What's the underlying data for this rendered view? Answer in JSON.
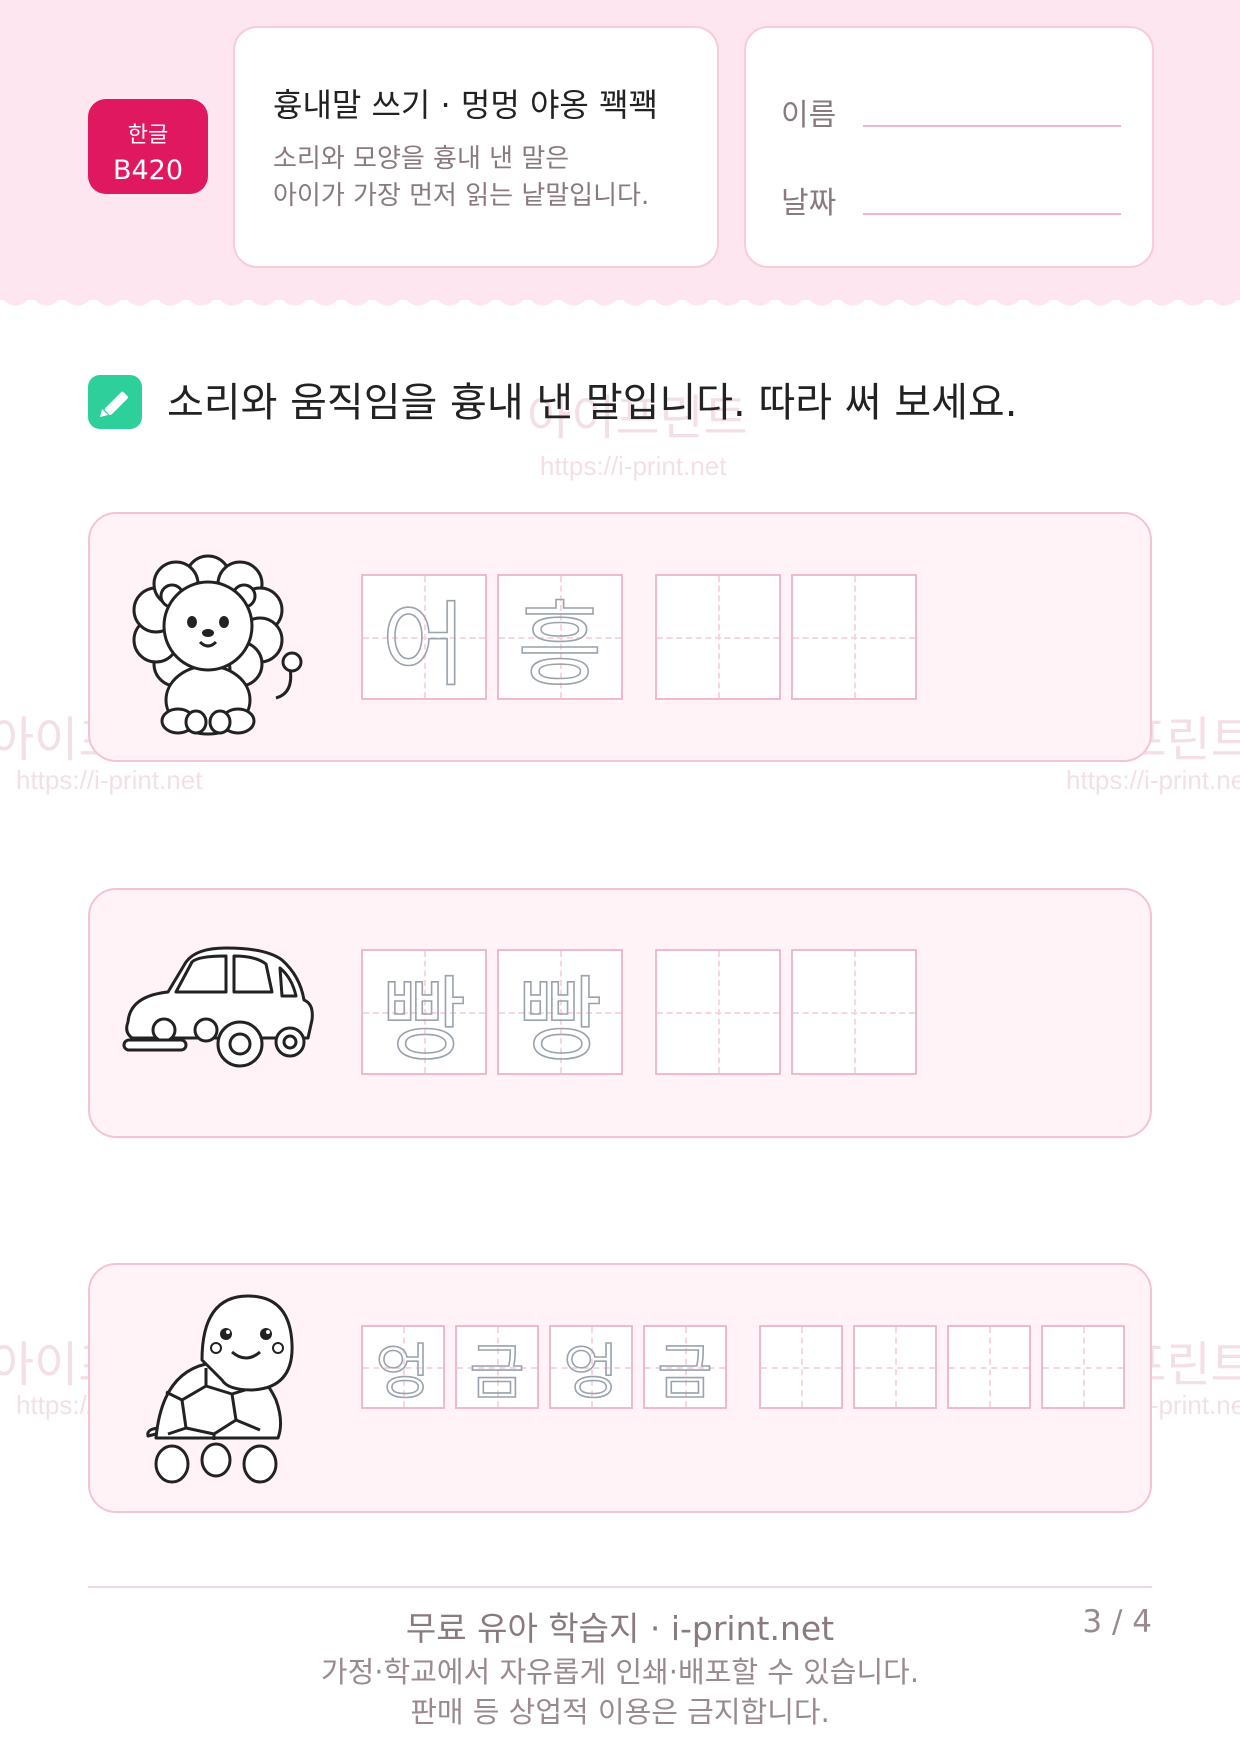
{
  "header": {
    "badge": {
      "line1": "한글",
      "line2": "B420"
    },
    "title": "흉내말 쓰기 · 멍멍 야옹 꽥꽥",
    "subtitle_lines": [
      "소리와 모양을 흉내 낸 말은",
      "아이가 가장 먼저 읽는 낱말입니다."
    ],
    "name_label": "이름",
    "date_label": "날짜"
  },
  "instruction": "소리와 움직임을 흉내 낸 말입니다. 따라 써 보세요.",
  "watermark": {
    "text": "아이프린트",
    "url": "https://i-print.net"
  },
  "rows": [
    {
      "picture": "lion-icon",
      "trace": [
        "어",
        "흥"
      ],
      "blank_count": 2
    },
    {
      "picture": "car-icon",
      "trace": [
        "빵",
        "빵"
      ],
      "blank_count": 2
    },
    {
      "picture": "turtle-icon",
      "trace": [
        "엉",
        "금",
        "엉",
        "금"
      ],
      "blank_count": 4
    }
  ],
  "footer": {
    "line1": "무료 유아 학습지 · i-print.net",
    "line2": "가정·학교에서 자유롭게 인쇄·배포할 수 있습니다.",
    "line3": "판매 등 상업적 이용은 금지합니다.",
    "page": "3 / 4"
  },
  "colors": {
    "accent": "#e0185f",
    "header_bg": "#fde6ef",
    "row_bg": "#fff3f7",
    "pencil": "#2ecf9a"
  }
}
